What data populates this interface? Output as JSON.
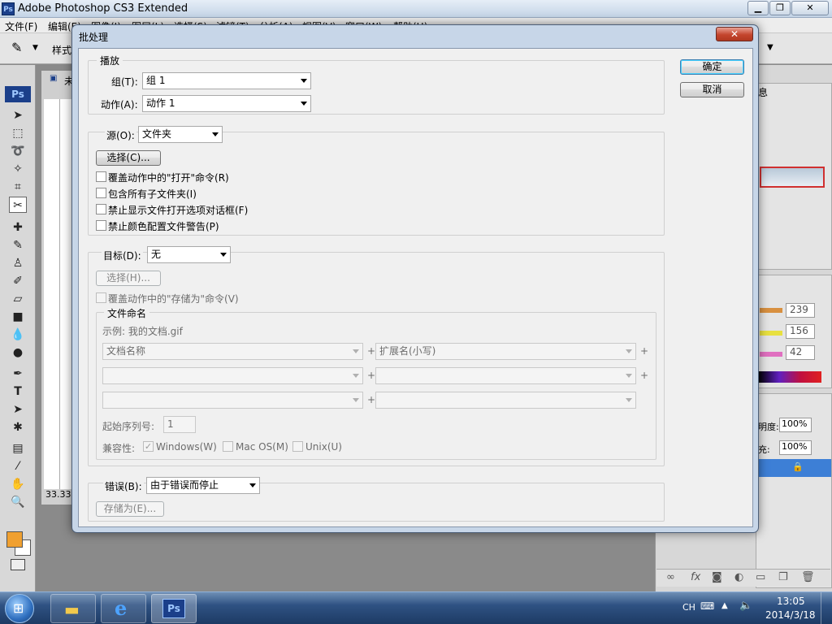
{
  "app": {
    "title": "Adobe Photoshop CS3 Extended",
    "icon_label": "Ps",
    "menus": [
      "文件(F)",
      "编辑(E)",
      "图像(I)",
      "图层(L)",
      "选择(S)",
      "滤镜(T)",
      "分析(A)",
      "视图(V)",
      "窗口(W)",
      "帮助(H)"
    ],
    "options_style_label": "样式",
    "toolbox_logo": "Ps",
    "doc_tab_partial": "未",
    "zoom_readout": "33.33",
    "color_values": [
      "239",
      "156",
      "42"
    ],
    "opacity_label": "明度:",
    "opacity_value": "100%",
    "fill_label": "充:",
    "fill_value": "100%",
    "panel_tab_partial": "息",
    "foreground_color": "#f0a030"
  },
  "dialog": {
    "title": "批处理",
    "close_symbol": "✕",
    "ok_label": "确定",
    "cancel_label": "取消",
    "play": {
      "group_label": "播放",
      "group_field_label": "组(T):",
      "group_value": "组 1",
      "action_field_label": "动作(A):",
      "action_value": "动作 1"
    },
    "source": {
      "label": "源(O):",
      "value": "文件夹",
      "choose_button": "选择(C)...",
      "options": [
        "覆盖动作中的\"打开\"命令(R)",
        "包含所有子文件夹(I)",
        "禁止显示文件打开选项对话框(F)",
        "禁止颜色配置文件警告(P)"
      ]
    },
    "destination": {
      "label": "目标(D):",
      "value": "无",
      "choose_button": "选择(H)...",
      "override_save": "覆盖动作中的\"存储为\"命令(V)",
      "file_naming_label": "文件命名",
      "example": "示例: 我的文档.gif",
      "naming_row1_left": "文档名称",
      "naming_row1_right": "扩展名(小写)",
      "plus": "+",
      "start_serial_label": "起始序列号:",
      "start_serial_value": "1",
      "compat_label": "兼容性:",
      "compat_windows": "Windows(W)",
      "compat_mac": "Mac OS(M)",
      "compat_unix": "Unix(U)"
    },
    "errors": {
      "label": "错误(B):",
      "value": "由于错误而停止",
      "save_as_button": "存储为(E)..."
    }
  },
  "taskbar": {
    "lang": "CH",
    "time": "13:05",
    "date": "2014/3/18",
    "ps_label": "Ps"
  }
}
